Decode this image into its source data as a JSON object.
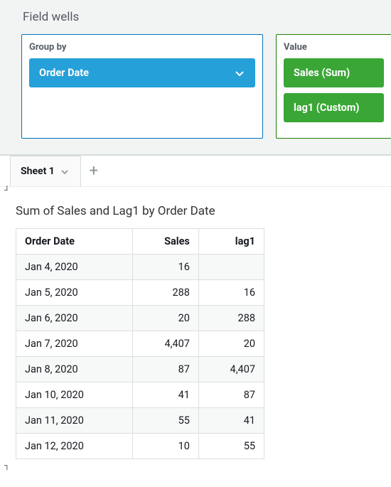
{
  "panel": {
    "title": "Field wells",
    "group_by": {
      "label": "Group by",
      "items": [
        "Order Date"
      ]
    },
    "value": {
      "label": "Value",
      "items": [
        "Sales (Sum)",
        "lag1 (Custom)"
      ]
    }
  },
  "tabs": {
    "active": "Sheet 1",
    "add_glyph": "+"
  },
  "viz": {
    "title": "Sum of Sales and Lag1 by Order Date"
  },
  "chart_data": {
    "type": "table",
    "columns": [
      "Order Date",
      "Sales",
      "lag1"
    ],
    "rows": [
      {
        "date": "Jan 4, 2020",
        "sales": "16",
        "lag1": ""
      },
      {
        "date": "Jan 5, 2020",
        "sales": "288",
        "lag1": "16"
      },
      {
        "date": "Jan 6, 2020",
        "sales": "20",
        "lag1": "288"
      },
      {
        "date": "Jan 7, 2020",
        "sales": "4,407",
        "lag1": "20"
      },
      {
        "date": "Jan 8, 2020",
        "sales": "87",
        "lag1": "4,407"
      },
      {
        "date": "Jan 10, 2020",
        "sales": "41",
        "lag1": "87"
      },
      {
        "date": "Jan 11, 2020",
        "sales": "55",
        "lag1": "41"
      },
      {
        "date": "Jan 12, 2020",
        "sales": "10",
        "lag1": "55"
      }
    ]
  }
}
